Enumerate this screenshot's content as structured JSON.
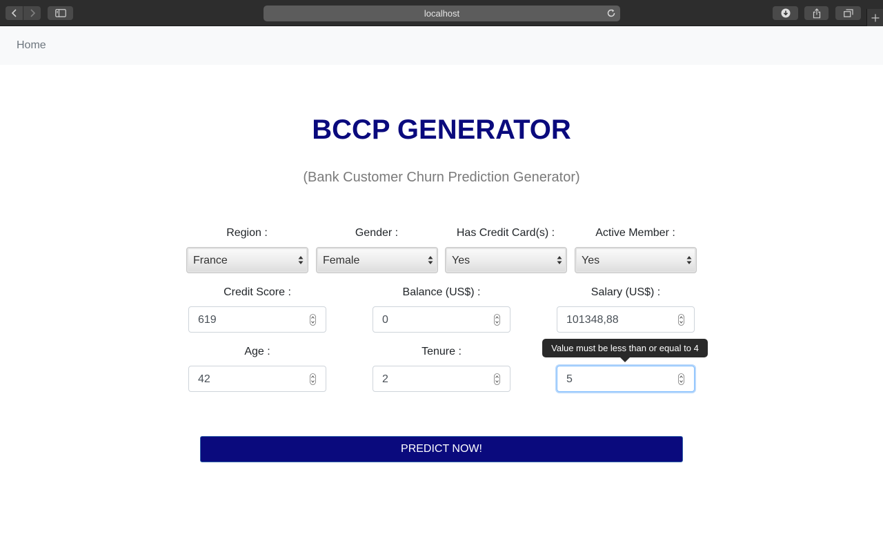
{
  "browser": {
    "url": "localhost",
    "icons": [
      "back-icon",
      "forward-icon",
      "sidebar-icon",
      "reload-icon",
      "download-icon",
      "share-icon",
      "tabs-icon",
      "plus-icon"
    ]
  },
  "navbar": {
    "home_label": "Home"
  },
  "header": {
    "title": "BCCP GENERATOR",
    "subtitle": "(Bank Customer Churn Prediction Generator)"
  },
  "form": {
    "region": {
      "label": "Region :",
      "value": "France"
    },
    "gender": {
      "label": "Gender :",
      "value": "Female"
    },
    "credit_card": {
      "label": "Has Credit Card(s) :",
      "value": "Yes"
    },
    "active_member": {
      "label": "Active Member :",
      "value": "Yes"
    },
    "credit_score": {
      "label": "Credit Score :",
      "value": "619"
    },
    "balance": {
      "label": "Balance (US$) :",
      "value": "0"
    },
    "salary": {
      "label": "Salary (US$) :",
      "value": "101348,88"
    },
    "age": {
      "label": "Age :",
      "value": "42"
    },
    "tenure": {
      "label": "Tenure :",
      "value": "2"
    },
    "products": {
      "value": "5"
    },
    "validation_tooltip": "Value must be less than or equal to 4",
    "submit_label": "PREDICT NOW!"
  },
  "colors": {
    "title": "#0a0a7d",
    "button": "#0a0a7d",
    "focus_border": "#80bdff"
  }
}
